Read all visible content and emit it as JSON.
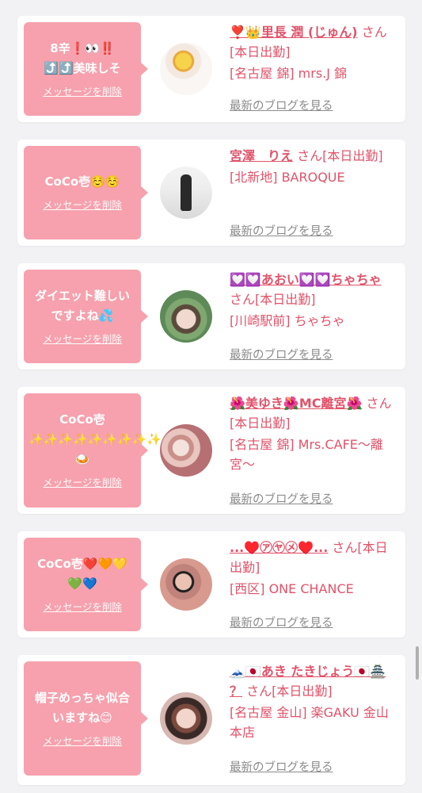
{
  "items": [
    {
      "message": "8辛❗👀‼️ ⤴️⤴️美味しそ",
      "delete_label": "メッセージを削除",
      "name": "❣️👑里長 潤 (じゅん)",
      "honorific": "さん[本日出勤]",
      "shop": "[名古屋 錦] mrs.J 錦",
      "blog_link": "最新のブログを見る",
      "avatar_icon": "avatar-sunflower"
    },
    {
      "message": "CoCo壱☺️☺️",
      "delete_label": "メッセージを削除",
      "name": "宮澤　りえ",
      "honorific": "さん[本日出勤]",
      "shop": "[北新地] BAROQUE",
      "blog_link": "最新のブログを見る",
      "avatar_icon": "avatar-dress"
    },
    {
      "message": "ダイエット難しいですよね💦",
      "delete_label": "メッセージを削除",
      "name": "💟💟あおい💟💟ちゃちゃ",
      "honorific": "さん[本日出勤]",
      "shop": "[川崎駅前] ちゃちゃ",
      "blog_link": "最新のブログを見る",
      "avatar_icon": "avatar-forest"
    },
    {
      "message": "CoCo壱 ✨✨✨✨✨✨✨✨✨🍛",
      "delete_label": "メッセージを削除",
      "name": "🌺美ゆき🌺MC離宮🌺",
      "honorific": "さん[本日出勤]",
      "shop": "[名古屋 錦] Mrs.CAFE〜離宮〜",
      "blog_link": "最新のブログを見る",
      "avatar_icon": "avatar-flowers"
    },
    {
      "message": "CoCo壱❤️🧡💛💚💙",
      "delete_label": "メッセージを削除",
      "name": "...♥️㋐㋳㋱♥️...",
      "honorific": "さん[本日出勤]",
      "shop": "[西区] ONE CHANCE",
      "blog_link": "最新のブログを見る",
      "avatar_icon": "avatar-sunglasses"
    },
    {
      "message": "帽子めっちゃ似合いますね😊",
      "delete_label": "メッセージを削除",
      "name": "🗻🇯🇵あき たきじょう🇯🇵🏯 ？",
      "honorific": "さん[本日出勤]",
      "shop": "[名古屋 金山] 楽GAKU 金山本店",
      "blog_link": "最新のブログを見る",
      "avatar_icon": "avatar-portrait"
    }
  ],
  "colors": {
    "accent": "#e0536a",
    "bubble": "#f6a1ad",
    "page_bg": "#f2f2f4",
    "link_gray": "#8c8c8c"
  }
}
